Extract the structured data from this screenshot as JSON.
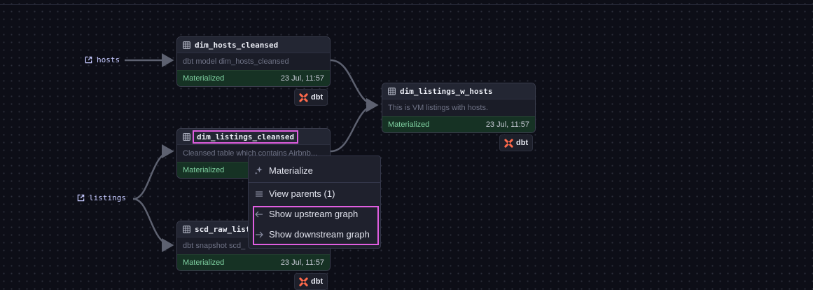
{
  "assets": {
    "hosts": "hosts",
    "listings": "listings"
  },
  "nodes": {
    "dim_hosts_cleansed": {
      "name": "dim_hosts_cleansed",
      "description": "dbt model dim_hosts_cleansed",
      "status": "Materialized",
      "date": "23 Jul, 11:57"
    },
    "dim_listings_cleansed": {
      "name": "dim_listings_cleansed",
      "description": "Cleansed table which contains Airbnb...",
      "status": "Materialized"
    },
    "scd_raw_listings": {
      "name": "scd_raw_list",
      "description": "dbt snapshot scd_",
      "status": "Materialized",
      "date": "23 Jul, 11:57"
    },
    "dim_listings_w_hosts": {
      "name": "dim_listings_w_hosts",
      "description": "This is VM listings with hosts.",
      "status": "Materialized",
      "date": "23 Jul, 11:57"
    }
  },
  "badge": {
    "label": "dbt"
  },
  "context_menu": {
    "materialize": "Materialize",
    "view_parents": "View parents (1)",
    "show_upstream": "Show upstream graph",
    "show_downstream": "Show downstream graph"
  },
  "colors": {
    "background": "#0d0e17",
    "card": "#1a1c27",
    "materialized_bg": "#163224",
    "materialized_text": "#7fd1a1",
    "highlight": "#e05ee0",
    "dbt_orange": "#ff694b",
    "asset_text": "#c5c9ff"
  },
  "icons": [
    "table-icon",
    "external-link-icon",
    "dbt-logo-icon",
    "sparkle-icon",
    "list-icon",
    "arrow-left-icon",
    "arrow-right-icon"
  ]
}
